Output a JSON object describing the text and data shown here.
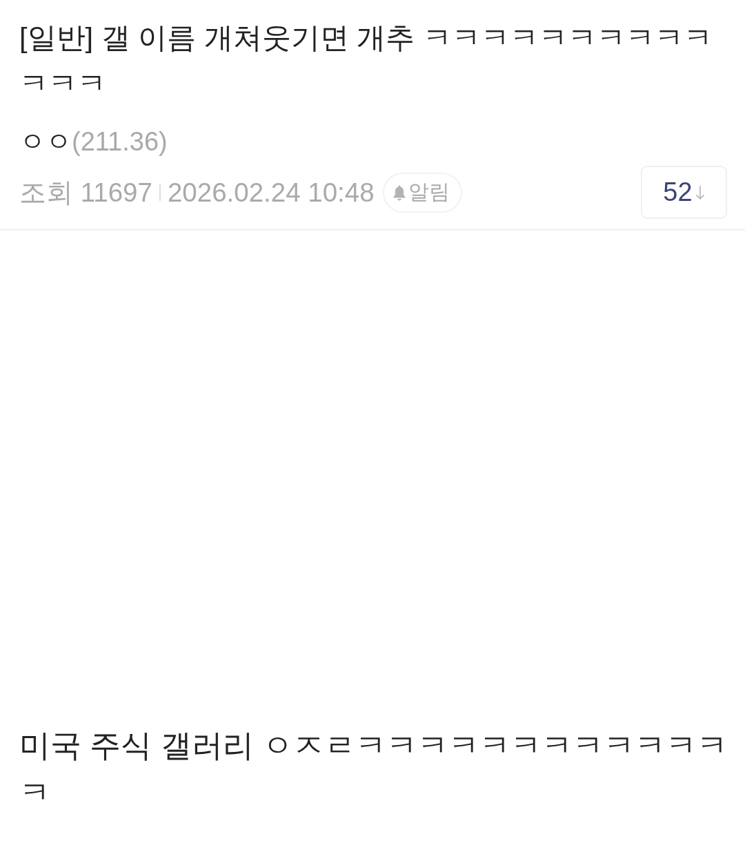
{
  "post": {
    "title": "[일반] 갤 이름 개쳐웃기면 개추 ㅋㅋㅋㅋㅋㅋㅋㅋㅋㅋㅋㅋㅋ",
    "author": {
      "nickname": "ㅇㅇ",
      "ip": "(211.36)"
    },
    "views": "조회 11697",
    "date": "2026.02.24 10:48",
    "alert_button": "알림",
    "comment_count": "52"
  },
  "body": {
    "text": "미국 주식 갤러리 ㅇㅈㄹㅋㅋㅋㅋㅋㅋㅋㅋㅋㅋㅋㅋㅋ"
  }
}
